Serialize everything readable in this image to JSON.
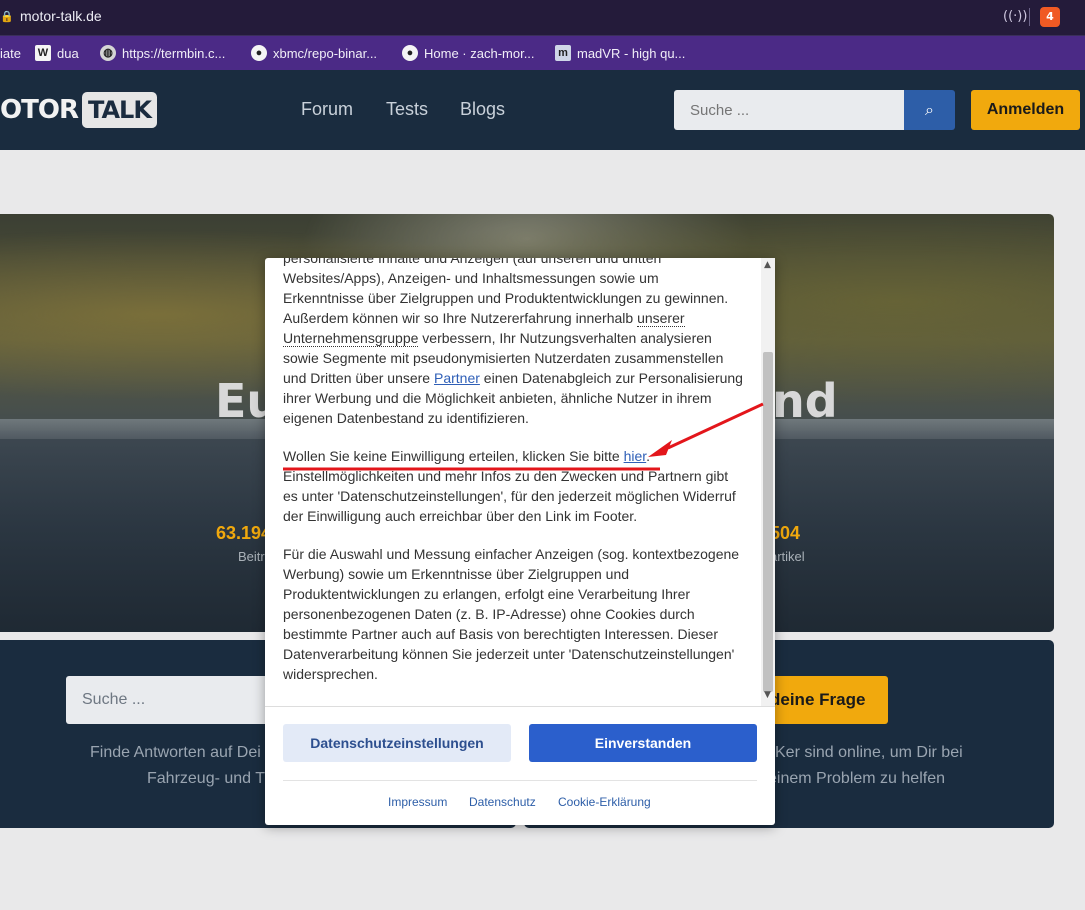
{
  "browser": {
    "url": "motor-talk.de",
    "bookmarks": [
      {
        "label": "iate",
        "icon": "none"
      },
      {
        "label": "dua",
        "icon": "wikipedia-icon"
      },
      {
        "label": "https://termbin.c...",
        "icon": "globe-icon"
      },
      {
        "label": "xbmc/repo-binar...",
        "icon": "github-icon"
      },
      {
        "label": "Home · zach-mor...",
        "icon": "github-icon"
      },
      {
        "label": "madVR - high qu...",
        "icon": "madvr-icon"
      }
    ],
    "brave_badge": "4"
  },
  "header": {
    "logo_motor": "OTOR",
    "logo_talk": "TALK",
    "nav": [
      "Forum",
      "Tests",
      "Blogs"
    ],
    "search_placeholder": "Suche ...",
    "login_label": "Anmelden"
  },
  "hero": {
    "title_left": "Eu",
    "title_right": "nd",
    "stat_left_value": "63.194",
    "stat_left_label": "Beitr",
    "stat_right_value": "504",
    "stat_right_label": "artikel"
  },
  "panels": {
    "search_placeholder": "Suche ...",
    "left_text_1": "Finde Antworten auf Dei",
    "left_text_2": "Fahrzeug- und Th",
    "ask_label": "deine Frage",
    "right_text_1": "Ker sind online, um Dir bei",
    "right_text_2": "einem Problem zu helfen"
  },
  "consent": {
    "para1_a": "personalisierte Inhalte und Anzeigen (auf unseren und dritten Websites/Apps), Anzeigen- und Inhaltsmessungen sowie um Erkenntnisse über Zielgruppen und Produktentwicklungen zu gewinnen. Außerdem können wir so Ihre Nutzererfahrung innerhalb ",
    "para1_link1": "unserer Unternehmensgruppe",
    "para1_b": " verbessern, Ihr Nutzungsverhalten analysieren sowie Segmente mit pseudonymisierten Nutzerdaten zusammenstellen und Dritten über unsere ",
    "para1_link2": "Partner",
    "para1_c": " einen Datenabgleich zur Personalisierung ihrer Werbung und die Möglichkeit anbieten, ähnliche Nutzer in ihrem eigenen Datenbestand zu identifizieren.",
    "para2_a": "Wollen Sie keine Einwilligung erteilen, klicken Sie bitte ",
    "para2_link": "hier",
    "para2_b": ". Einstellmöglichkeiten und mehr Infos zu den Zwecken und Partnern gibt es unter 'Datenschutzeinstellungen', für den jederzeit möglichen Widerruf der Einwilligung auch erreichbar über den Link im Footer.",
    "para3": "Für die Auswahl und Messung einfacher Anzeigen (sog. kontextbezogene Werbung) sowie um Erkenntnisse über Zielgruppen und Produktentwicklungen zu erlangen, erfolgt eine Verarbeitung Ihrer personenbezogenen Daten (z. B. IP-Adresse) ohne Cookies durch bestimmte Partner auch auf Basis von berechtigten Interessen. Dieser Datenverarbeitung können Sie jederzeit unter 'Datenschutzeinstellungen' widersprechen.",
    "btn_settings": "Datenschutzeinstellungen",
    "btn_agree": "Einverstanden",
    "footer_links": [
      "Impressum",
      "Datenschutz",
      "Cookie-Erklärung"
    ]
  },
  "colors": {
    "accent": "#f1a90d",
    "header_bg": "#1a2c3f",
    "primary_button": "#2b5fcc",
    "annotation": "#e3161b"
  }
}
